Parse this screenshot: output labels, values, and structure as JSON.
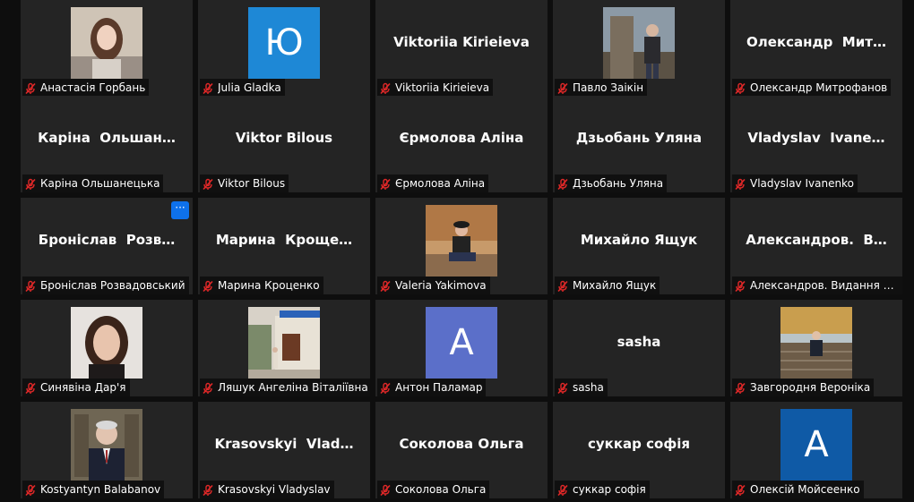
{
  "colors": {
    "tile_bg": "#242424",
    "page_bg": "#0e0e0e",
    "muted_mic": "#e02828",
    "more_button": "#0e71eb",
    "initial_blue": "#1e88d6",
    "initial_purple": "#5b6fc9",
    "initial_navy": "#0f5aa6"
  },
  "participants": [
    {
      "name": "Анастасія Горбань",
      "display": "photo",
      "photo": "woman-long-hair-light-bg",
      "muted": true
    },
    {
      "name": "Julia Gladka",
      "display": "initial",
      "initial": "Ю",
      "initial_color": "#1e88d6",
      "muted": true
    },
    {
      "name": "Viktoriia Kirieieva",
      "display": "text",
      "center": "Viktoriia Kirieieva",
      "muted": true
    },
    {
      "name": "Павло Заікін",
      "display": "photo",
      "photo": "man-standing-outdoors-monument",
      "muted": true
    },
    {
      "name": "Олександр Митрофанов",
      "display": "text",
      "center": "Олександр  Мит…",
      "muted": true
    },
    {
      "name": "Каріна Ольшанецька",
      "display": "text",
      "center": "Каріна  Ольшан…",
      "muted": true
    },
    {
      "name": "Viktor Bilous",
      "display": "text",
      "center": "Viktor Bilous",
      "muted": true
    },
    {
      "name": "Єрмолова Аліна",
      "display": "text",
      "center": "Єрмолова Аліна",
      "muted": true
    },
    {
      "name": "Дзьобань Уляна",
      "display": "text",
      "center": "Дзьобань Уляна",
      "muted": true
    },
    {
      "name": "Vladyslav Ivanenko",
      "display": "text",
      "center": "Vladyslav  Ivane…",
      "muted": true
    },
    {
      "name": "Броніслав Розвадовський",
      "display": "text",
      "center": "Броніслав  Розв…",
      "muted": true,
      "more_button": "···"
    },
    {
      "name": "Марина Кроценко",
      "display": "text",
      "center": "Марина  Кроще…",
      "muted": true
    },
    {
      "name": "Valeria Yakimova",
      "display": "photo",
      "photo": "woman-seated-autumn-trees",
      "muted": true
    },
    {
      "name": "Михайло Ящук",
      "display": "text",
      "center": "Михайло Ящук",
      "muted": true
    },
    {
      "name": "Александров. Видання ДЕ…",
      "display": "text",
      "center": "Александров.  В…",
      "muted": true
    },
    {
      "name": "Синявіна Дар'я",
      "display": "photo",
      "photo": "woman-portrait-dark-hair",
      "muted": true
    },
    {
      "name": "Ляшук Ангеліна Віталіївна",
      "display": "photo",
      "photo": "woman-in-front-of-building",
      "muted": true
    },
    {
      "name": "Антон Паламар",
      "display": "initial",
      "initial": "A",
      "initial_color": "#5b6fc9",
      "muted": true
    },
    {
      "name": "sasha",
      "display": "text",
      "center": "sasha",
      "muted": true
    },
    {
      "name": "Завгородня Вероніка",
      "display": "photo",
      "photo": "person-sitting-on-steps-autumn",
      "muted": true
    },
    {
      "name": "Kostyantyn Balabanov",
      "display": "photo",
      "photo": "man-in-suit-bookshelves",
      "muted": true
    },
    {
      "name": "Krasovskyi Vladyslav",
      "display": "text",
      "center": "Krasovskyi  Vlad…",
      "muted": true
    },
    {
      "name": "Соколова Ольга",
      "display": "text",
      "center": "Соколова Ольга",
      "muted": true
    },
    {
      "name": "суккар софія",
      "display": "text",
      "center": "суккар софія",
      "muted": true
    },
    {
      "name": "Олексій Мойсеенко",
      "display": "initial",
      "initial": "A",
      "initial_color": "#0f5aa6",
      "muted": true
    }
  ]
}
